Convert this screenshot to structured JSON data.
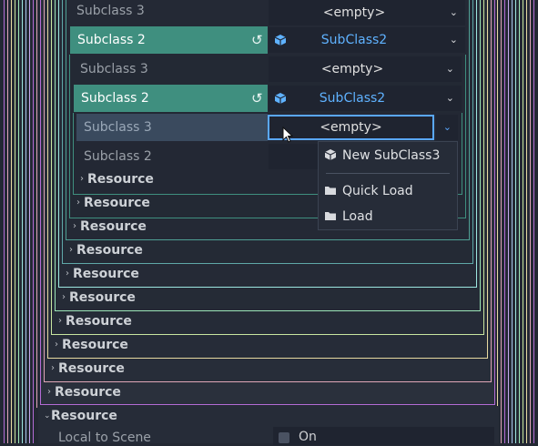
{
  "rows": {
    "r1_label": "Subclass 3",
    "r1_value": "<empty>",
    "r2_label": "Subclass 2",
    "r2_value": "SubClass2",
    "r3_label": "Subclass 3",
    "r3_value": "<empty>",
    "r4_label": "Subclass 2",
    "r4_value": "SubClass2",
    "r5_label": "Subclass 3",
    "r5_value": "<empty>",
    "r6_label": "Subclass 2"
  },
  "resource_label": "Resource",
  "bottom": {
    "section_label": "Resource",
    "local_to_scene_label": "Local to Scene",
    "toggle_label": "On"
  },
  "popup": {
    "items": [
      "New SubClass3",
      "Quick Load",
      "Load"
    ]
  },
  "icons": {
    "revert": "revert-icon",
    "cube": "cube-icon",
    "chevron": "chevron-down-icon",
    "folder": "folder-icon",
    "arrow": "chevron-right-icon",
    "cursor": "mouse-cursor-icon"
  },
  "colors": {
    "background": "#232833",
    "active_row": "#3f8f7f",
    "hover_row": "#3a4a5e",
    "focus_border": "#5aa8ff",
    "subclass_text": "#5fb2ff",
    "nest_palette": [
      "#b46cd6",
      "#e0a6b8",
      "#e6d9a0",
      "#c8e6a0",
      "#9ce6b8",
      "#9ce6e0",
      "#a8c8ee",
      "#c6a8ee"
    ]
  }
}
